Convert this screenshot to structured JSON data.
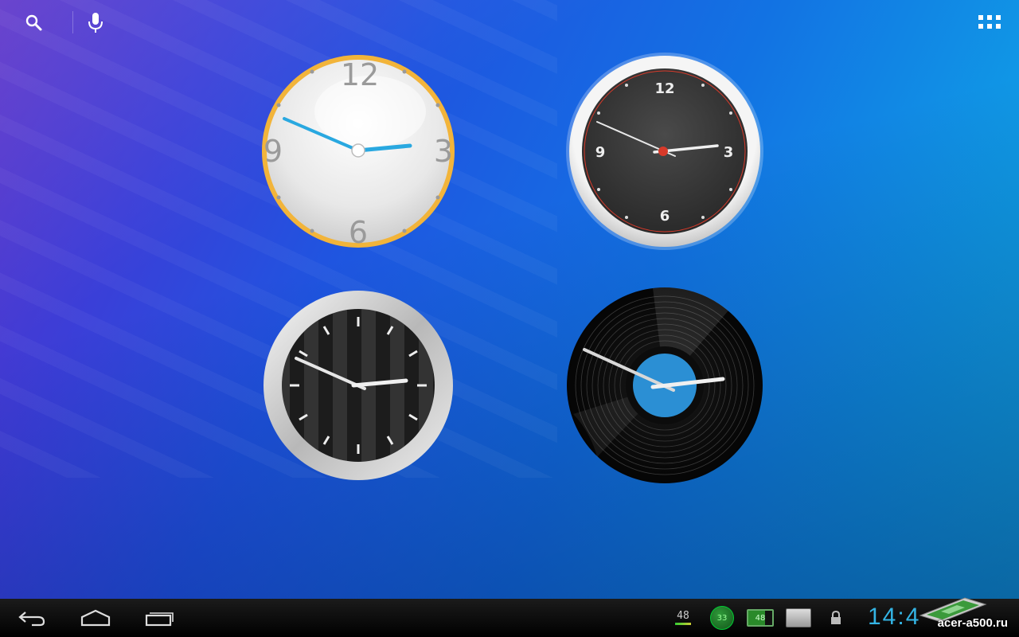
{
  "top_bar": {
    "search_icon": "search-icon",
    "voice_icon": "microphone-icon",
    "apps_icon": "apps-grid-icon"
  },
  "clocks": [
    {
      "name": "white-gold-clock",
      "numerals": [
        "12",
        "3",
        "6",
        "9"
      ],
      "hour_hand_color": "#29a8e0",
      "rim_color": "#f2b43a"
    },
    {
      "name": "dark-silver-clock",
      "numerals": [
        "12",
        "3",
        "6",
        "9"
      ],
      "accent_color": "#d83a2a"
    },
    {
      "name": "striped-chrome-clock"
    },
    {
      "name": "vinyl-record-clock",
      "label_color": "#2b8fd4"
    }
  ],
  "status_bar": {
    "count_value": "48",
    "circle_value": "33",
    "battery_value": "48",
    "time": "14:4",
    "time_color": "#34b4e4"
  },
  "watermark": {
    "text": "acer-a500.ru"
  },
  "nav_bar": {
    "back_icon": "back-arrow-icon",
    "home_icon": "home-icon",
    "recents_icon": "recent-apps-icon"
  }
}
